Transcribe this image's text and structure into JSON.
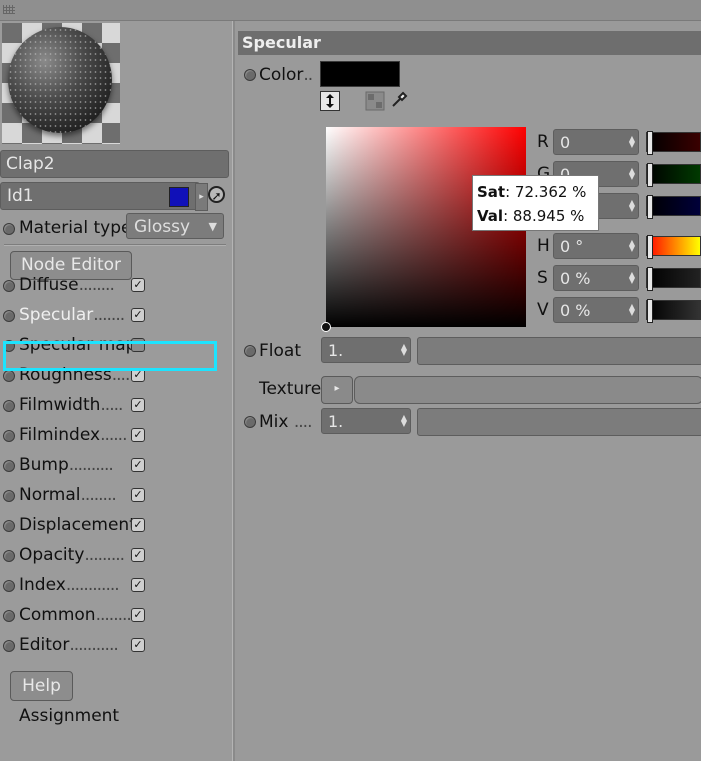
{
  "material": {
    "name": "Clap2",
    "id": "Id1",
    "id_color": "#1010b8",
    "material_type_label": "Material type",
    "material_type_value": "Glossy",
    "node_editor_label": "Node Editor",
    "help_label": "Help",
    "assignment_label": "Assignment"
  },
  "channels": [
    {
      "label": "Diffuse",
      "dots": "........",
      "checked": true
    },
    {
      "label": "Specular",
      "dots": ".......",
      "checked": true
    },
    {
      "label": "Specular map",
      "dots": "",
      "checked": false
    },
    {
      "label": "Roughness",
      "dots": "....",
      "checked": true
    },
    {
      "label": "Filmwidth",
      "dots": ".....",
      "checked": true
    },
    {
      "label": "Filmindex",
      "dots": "......",
      "checked": true
    },
    {
      "label": "Bump",
      "dots": "..........",
      "checked": true
    },
    {
      "label": "Normal",
      "dots": "........",
      "checked": true
    },
    {
      "label": "Displacement",
      "dots": "",
      "checked": true
    },
    {
      "label": "Opacity",
      "dots": ".........",
      "checked": true
    },
    {
      "label": "Index",
      "dots": "............",
      "checked": true
    },
    {
      "label": "Common",
      "dots": ".........",
      "checked": true
    },
    {
      "label": "Editor",
      "dots": "...........",
      "checked": true
    }
  ],
  "specular": {
    "title": "Specular",
    "color_label": "Color",
    "color_value": "#000000",
    "sliders": [
      {
        "label": "R",
        "value": "0"
      },
      {
        "label": "G",
        "value": "0"
      },
      {
        "label": "B",
        "value": "0"
      },
      {
        "label": "H",
        "value": "0 °"
      },
      {
        "label": "S",
        "value": "0 %"
      },
      {
        "label": "V",
        "value": "0 %"
      }
    ],
    "tooltip": {
      "sat_label": "Sat",
      "sat_value": ": 72.362 %",
      "val_label": "Val",
      "val_value": ": 88.945 %"
    },
    "float_label": "Float",
    "float_value": "1.",
    "texture_label": "Texture",
    "mix_label": "Mix",
    "mix_dots": "....",
    "mix_value": "1."
  },
  "colors": {
    "highlight": "#1de4ff"
  }
}
